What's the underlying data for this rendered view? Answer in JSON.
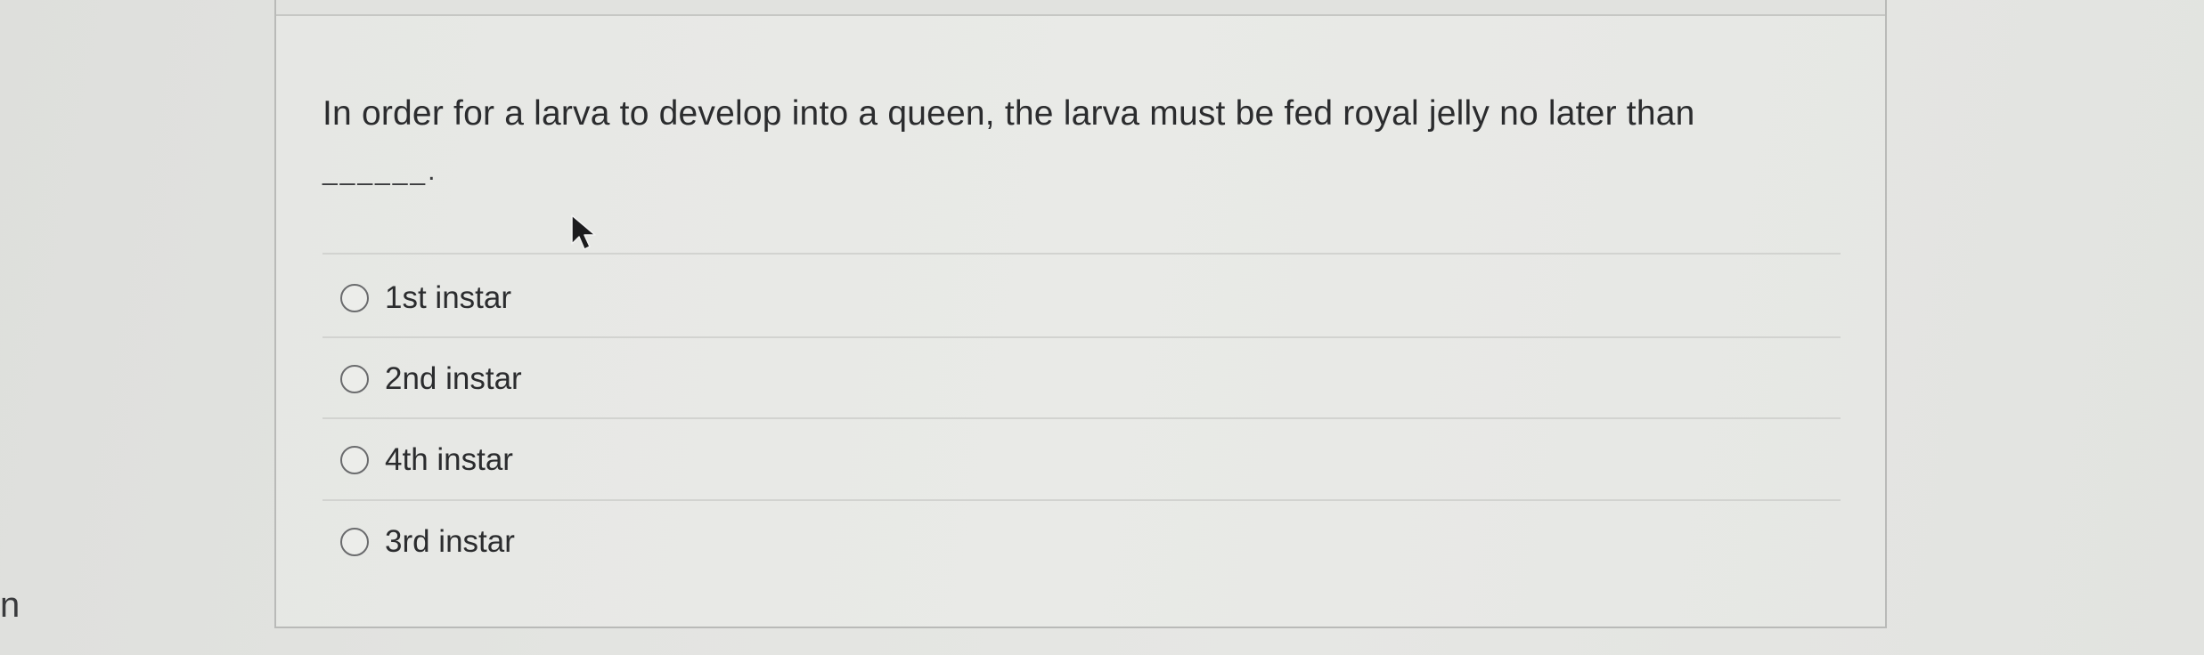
{
  "edge_text": "n",
  "question": {
    "text": "In order for a larva to develop into a queen, the larva must be fed royal jelly no later than",
    "blank": "______."
  },
  "options": [
    {
      "label": "1st instar",
      "selected": false
    },
    {
      "label": "2nd instar",
      "selected": false
    },
    {
      "label": "4th instar",
      "selected": false
    },
    {
      "label": "3rd instar",
      "selected": false
    }
  ],
  "icons": {
    "cursor": "mouse-pointer-icon",
    "radio": "radio-unchecked-icon"
  },
  "colors": {
    "background": "#e3e4e1",
    "panel": "#e8e9e6",
    "border": "#b9bab8",
    "text": "#2b2c2e"
  }
}
